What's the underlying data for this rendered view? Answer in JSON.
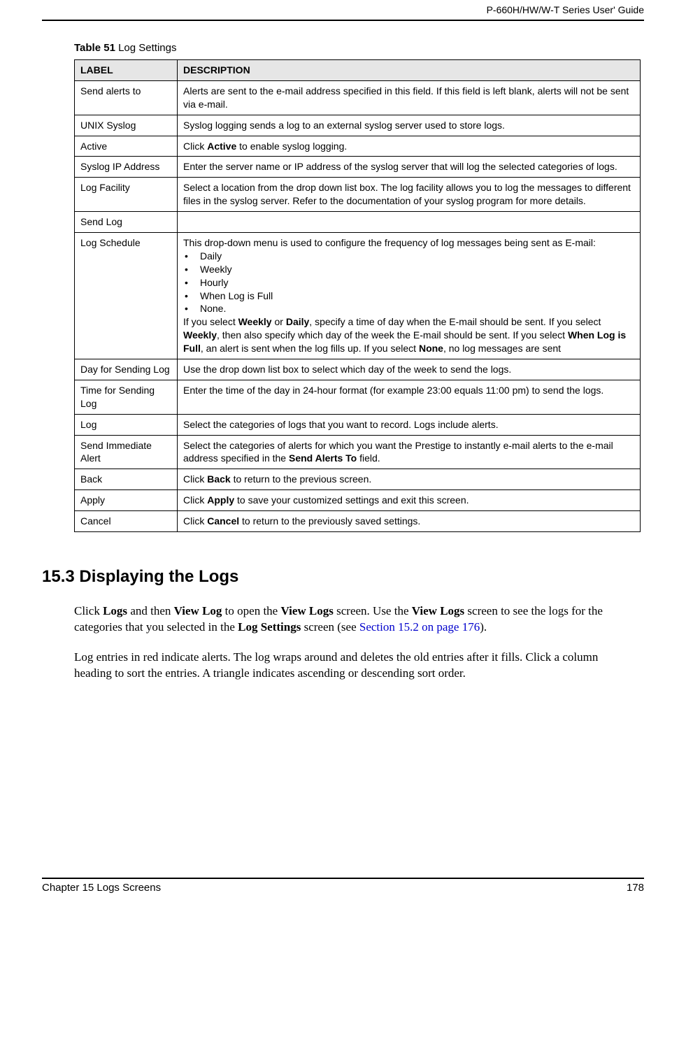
{
  "header": {
    "guide_title": "P-660H/HW/W-T Series User' Guide"
  },
  "table": {
    "caption_bold": "Table 51",
    "caption_rest": "   Log Settings",
    "col_label": "LABEL",
    "col_desc": "DESCRIPTION",
    "rows": [
      {
        "label": "Send alerts to",
        "desc": "Alerts are sent to the e-mail address specified in this field. If this field is left blank, alerts will not be sent via e-mail."
      },
      {
        "label": "UNIX Syslog",
        "desc": "Syslog logging sends a log to an external syslog server used to store logs."
      },
      {
        "label": "Active",
        "desc_pre": "Click ",
        "desc_bold1": "Active",
        "desc_post": " to enable syslog logging."
      },
      {
        "label": "Syslog IP Address",
        "desc": "Enter the server name or IP address of the syslog server that will log the selected categories of logs."
      },
      {
        "label": "Log Facility",
        "desc": "Select a location from the drop down list box. The log facility allows you to log the messages to different files in the syslog server. Refer to the documentation of your syslog program for more details."
      },
      {
        "label": "Send Log",
        "desc": ""
      },
      {
        "label": "Log Schedule",
        "desc_intro": "This drop-down menu is used to configure the frequency of log messages being sent as E-mail:",
        "bullets": [
          "Daily",
          "Weekly",
          "Hourly",
          "When Log is Full",
          "None."
        ],
        "desc_after_1": "If you select ",
        "desc_b1": "Weekly",
        "desc_after_2": " or ",
        "desc_b2": "Daily",
        "desc_after_3": ", specify a time of day when the E-mail should be sent. If you select ",
        "desc_b3": "Weekly",
        "desc_after_4": ", then also specify which day of the week the E-mail should be sent. If you select ",
        "desc_b4": "When Log is Full",
        "desc_after_5": ", an alert is sent when the log fills up. If you select ",
        "desc_b5": "None",
        "desc_after_6": ", no log messages are sent"
      },
      {
        "label": "Day for Sending Log",
        "desc": "Use the drop down list box to select which day of the week to send the logs."
      },
      {
        "label": "Time for Sending Log",
        "desc": "Enter the time of the day in 24-hour format (for example 23:00 equals 11:00 pm) to send the logs."
      },
      {
        "label": "Log",
        "desc": "Select the categories of logs that you want to record. Logs include alerts."
      },
      {
        "label": "Send Immediate Alert",
        "desc_pre": "Select the categories of alerts for which you want the Prestige to instantly e-mail alerts to the e-mail address specified in the ",
        "desc_bold1": "Send Alerts To",
        "desc_post": " field."
      },
      {
        "label": "Back",
        "desc_pre": "Click ",
        "desc_bold1": "Back",
        "desc_post": " to return to the previous screen."
      },
      {
        "label": "Apply",
        "desc_pre": "Click ",
        "desc_bold1": "Apply",
        "desc_post": " to save your customized settings and exit this screen."
      },
      {
        "label": "Cancel",
        "desc_pre": "Click ",
        "desc_bold1": "Cancel",
        "desc_post": " to return to the previously saved settings."
      }
    ]
  },
  "section": {
    "heading": "15.3  Displaying the Logs",
    "para1_pre": "Click ",
    "para1_b1": "Logs",
    "para1_mid1": " and then ",
    "para1_b2": "View Log",
    "para1_mid2": " to open the ",
    "para1_b3": "View Logs",
    "para1_mid3": " screen. Use the ",
    "para1_b4": "View Logs",
    "para1_mid4": " screen to see the logs for the categories that you selected in the ",
    "para1_b5": "Log Settings",
    "para1_mid5": " screen (see ",
    "para1_link": "Section 15.2 on page 176",
    "para1_end": ").",
    "para2": "Log entries in red indicate alerts. The log wraps around and deletes the old entries after it fills. Click a column heading to sort the entries. A triangle indicates ascending or descending sort order."
  },
  "footer": {
    "left": "Chapter 15 Logs Screens",
    "right": "178"
  }
}
